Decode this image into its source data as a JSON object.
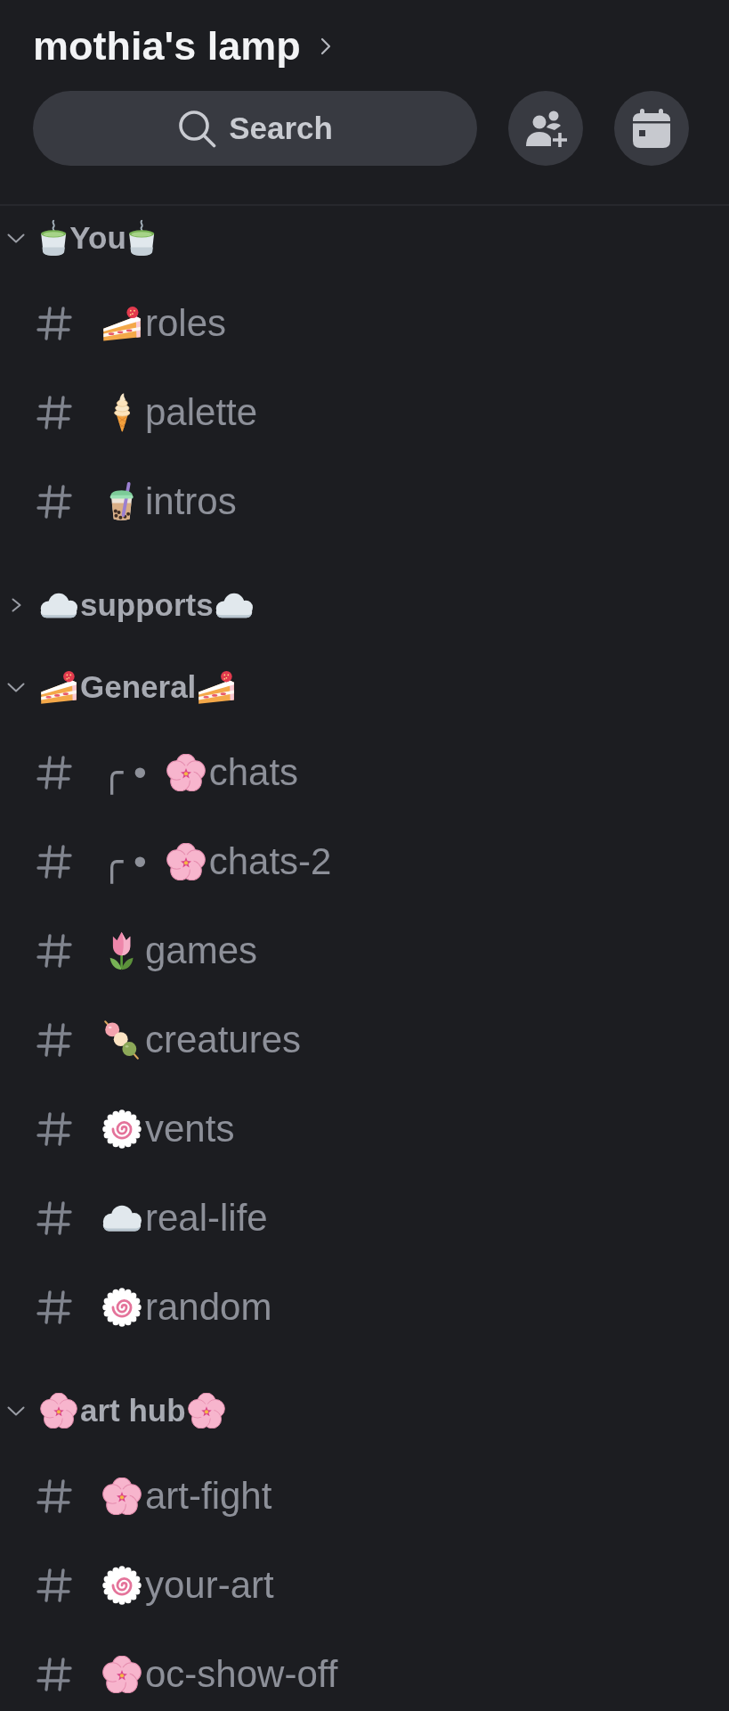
{
  "server": {
    "name": "mothia's lamp"
  },
  "search": {
    "label": "Search"
  },
  "categories": [
    {
      "name": "You",
      "kind": "tea",
      "expanded": true,
      "channels": [
        {
          "kind": "cake",
          "name": "roles"
        },
        {
          "kind": "ice-cream",
          "name": "palette"
        },
        {
          "kind": "bubble-tea",
          "name": "intros"
        }
      ]
    },
    {
      "name": "supports",
      "kind": "cloud",
      "expanded": false
    },
    {
      "name": "General",
      "kind": "cake",
      "expanded": true,
      "channels": [
        {
          "prefix": "╭ •",
          "kind": "blossom",
          "name": "chats"
        },
        {
          "prefix": "╭ •",
          "kind": "blossom",
          "name": "chats-2"
        },
        {
          "kind": "tulip",
          "name": "games"
        },
        {
          "kind": "dango",
          "name": "creatures"
        },
        {
          "kind": "fishcake",
          "name": "vents"
        },
        {
          "kind": "cloud",
          "name": "real-life"
        },
        {
          "kind": "fishcake",
          "name": "random"
        }
      ]
    },
    {
      "name": "art hub",
      "kind": "blossom",
      "expanded": true,
      "channels": [
        {
          "kind": "blossom",
          "name": "art-fight"
        },
        {
          "kind": "fishcake",
          "name": "your-art"
        },
        {
          "kind": "blossom",
          "name": "oc-show-off"
        }
      ]
    }
  ]
}
